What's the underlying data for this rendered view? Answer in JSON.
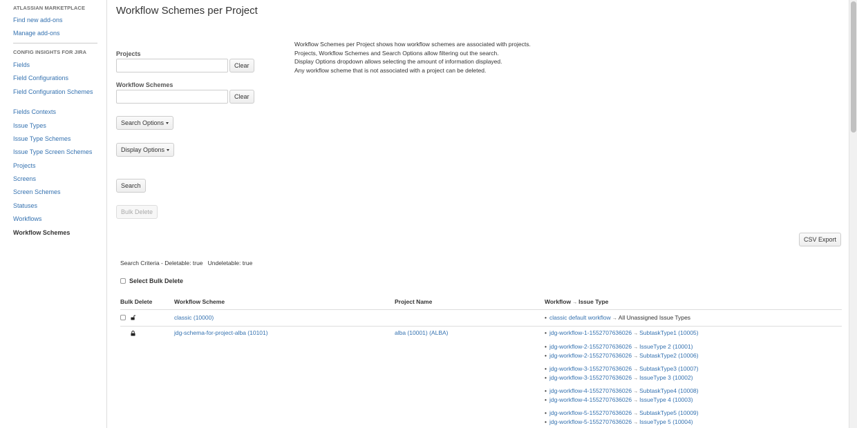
{
  "sidebar": {
    "heading1": "ATLASSIAN MARKETPLACE",
    "marketplace_items": [
      "Find new add-ons",
      "Manage add-ons"
    ],
    "heading2": "CONFIG INSIGHTS FOR JIRA",
    "items": [
      "Fields",
      "Field Configurations",
      "Field Configuration Schemes",
      "Fields Contexts",
      "Issue Types",
      "Issue Type Schemes",
      "Issue Type Screen Schemes",
      "Projects",
      "Screens",
      "Screen Schemes",
      "Statuses",
      "Workflows",
      "Workflow Schemes"
    ],
    "active_item": "Workflow Schemes"
  },
  "page": {
    "title": "Workflow Schemes per Project"
  },
  "filters": {
    "projects_label": "Projects",
    "projects_value": "",
    "schemes_label": "Workflow Schemes",
    "schemes_value": "",
    "clear_label": "Clear",
    "search_options_label": "Search Options",
    "display_options_label": "Display Options",
    "search_label": "Search",
    "bulk_delete_label": "Bulk Delete"
  },
  "info": [
    "Workflow Schemes per Project shows how workflow schemes are associated with projects.",
    "Projects, Workflow Schemes and Search Options allow filtering out the search.",
    "Display Options dropdown allows selecting the amount of information displayed.",
    "Any workflow scheme that is not associated with a project can be deleted."
  ],
  "csv_export_label": "CSV Export",
  "search_criteria": "Search Criteria - Deletable: true   Undeletable: true",
  "select_bulk_delete_label": "Select Bulk Delete",
  "table": {
    "headers": [
      "Bulk Delete",
      "Workflow Scheme",
      "Project Name",
      "Workflow",
      "Issue Type"
    ],
    "rows": [
      {
        "scheme": "classic (10000)",
        "project": "",
        "deletable": true,
        "mappings": [
          [
            {
              "workflow": "classic default workflow",
              "issue_type": "All Unassigned Issue Types",
              "issue_type_link": false
            }
          ]
        ]
      },
      {
        "scheme": "jdg-schema-for-project-alba (10101)",
        "project": "alba (10001) (ALBA)",
        "deletable": false,
        "mappings": [
          [
            {
              "workflow": "jdg-workflow-1-1552707636026",
              "issue_type": "SubtaskType1 (10005)",
              "issue_type_link": true
            }
          ],
          [
            {
              "workflow": "jdg-workflow-2-1552707636026",
              "issue_type": "IssueType 2 (10001)",
              "issue_type_link": true
            },
            {
              "workflow": "jdg-workflow-2-1552707636026",
              "issue_type": "SubtaskType2 (10006)",
              "issue_type_link": true
            }
          ],
          [
            {
              "workflow": "jdg-workflow-3-1552707636026",
              "issue_type": "SubtaskType3 (10007)",
              "issue_type_link": true
            },
            {
              "workflow": "jdg-workflow-3-1552707636026",
              "issue_type": "IssueType 3 (10002)",
              "issue_type_link": true
            }
          ],
          [
            {
              "workflow": "jdg-workflow-4-1552707636026",
              "issue_type": "SubtaskType4 (10008)",
              "issue_type_link": true
            },
            {
              "workflow": "jdg-workflow-4-1552707636026",
              "issue_type": "IssueType 4 (10003)",
              "issue_type_link": true
            }
          ],
          [
            {
              "workflow": "jdg-workflow-5-1552707636026",
              "issue_type": "SubtaskType5 (10009)",
              "issue_type_link": true
            },
            {
              "workflow": "jdg-workflow-5-1552707636026",
              "issue_type": "IssueType 5 (10004)",
              "issue_type_link": true
            }
          ]
        ]
      }
    ]
  },
  "colors": {
    "link": "#3572b0",
    "text": "#333333",
    "border": "#dddddd"
  }
}
